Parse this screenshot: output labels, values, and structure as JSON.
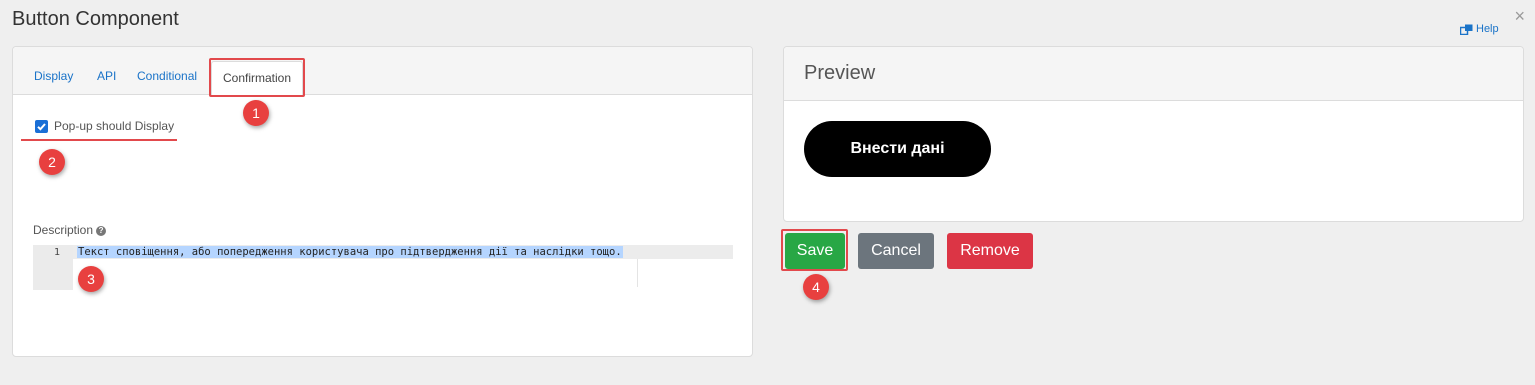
{
  "dialog": {
    "title": "Button Component",
    "close_glyph": "×",
    "help_label": "Help",
    "help_icon": "external-link-icon"
  },
  "tabs": [
    {
      "label": "Display",
      "active": false
    },
    {
      "label": "API",
      "active": false
    },
    {
      "label": "Conditional",
      "active": false
    },
    {
      "label": "Confirmation",
      "active": true
    }
  ],
  "confirmation": {
    "popup_checkbox_label": "Pop-up should Display",
    "popup_checked": true,
    "description_label": "Description",
    "help_glyph": "?",
    "editor": {
      "line_number": "1",
      "text": "Текст сповіщення, або попередження користувача про підтвердження дії та наслідки тощо."
    }
  },
  "preview": {
    "title": "Preview",
    "button_label": "Внести дані"
  },
  "actions": {
    "save_label": "Save",
    "cancel_label": "Cancel",
    "remove_label": "Remove"
  },
  "annotations": [
    "1",
    "2",
    "3",
    "4"
  ],
  "colors": {
    "link": "#1a73c8",
    "save": "#28a745",
    "cancel": "#6c757d",
    "remove": "#dc3545",
    "annotation": "#e8403f",
    "preview_button": "#000000"
  }
}
